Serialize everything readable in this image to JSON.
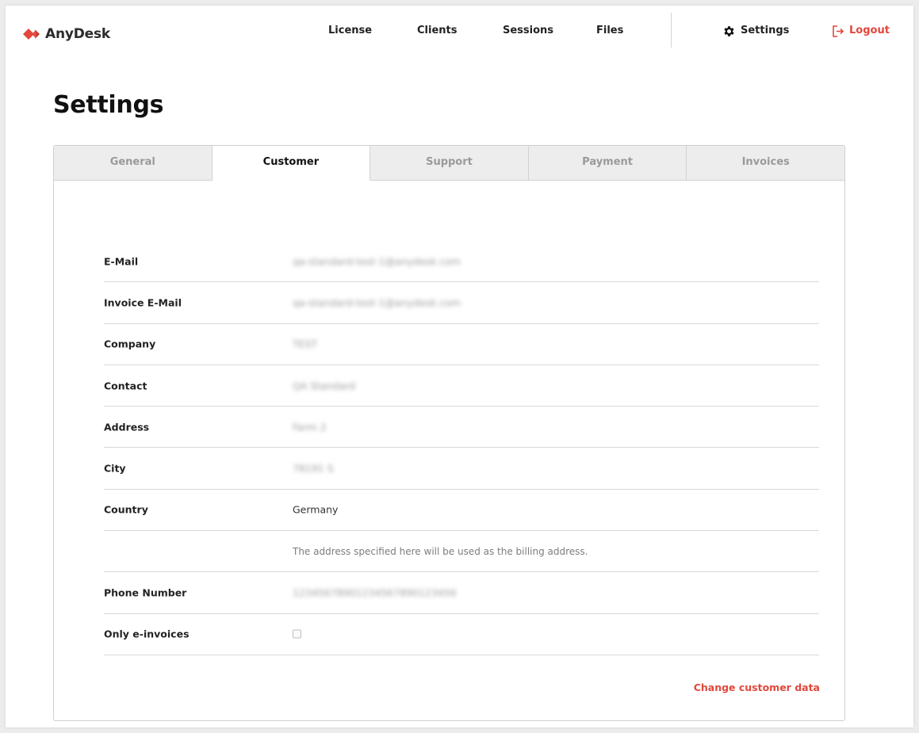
{
  "brand": {
    "name": "AnyDesk",
    "color": "#e2473c"
  },
  "nav": {
    "license": "License",
    "clients": "Clients",
    "sessions": "Sessions",
    "files": "Files",
    "settings": "Settings",
    "logout": "Logout"
  },
  "page": {
    "title": "Settings"
  },
  "tabs": [
    {
      "label": "General",
      "active": false
    },
    {
      "label": "Customer",
      "active": true
    },
    {
      "label": "Support",
      "active": false
    },
    {
      "label": "Payment",
      "active": false
    },
    {
      "label": "Invoices",
      "active": false
    }
  ],
  "customer": {
    "email": {
      "label": "E-Mail",
      "value": "qa-standard-test-1@anydesk.com"
    },
    "invoice_email": {
      "label": "Invoice E-Mail",
      "value": "qa-standard-test-1@anydesk.com"
    },
    "company": {
      "label": "Company",
      "value": "TEST"
    },
    "contact": {
      "label": "Contact",
      "value": "QA Standard"
    },
    "address": {
      "label": "Address",
      "value": "Farm 2"
    },
    "city": {
      "label": "City",
      "value": "78191 S"
    },
    "country": {
      "label": "Country",
      "value": "Germany"
    },
    "billing_hint": "The address specified here will be used as the billing address.",
    "phone": {
      "label": "Phone Number",
      "value": "12345678901234567890123456"
    },
    "e_invoices": {
      "label": "Only e-invoices",
      "checked": false
    }
  },
  "actions": {
    "change_customer_data": "Change customer data"
  },
  "icons": {
    "logo": "anydesk-logo-icon",
    "settings": "gear-icon",
    "logout": "logout-icon"
  }
}
